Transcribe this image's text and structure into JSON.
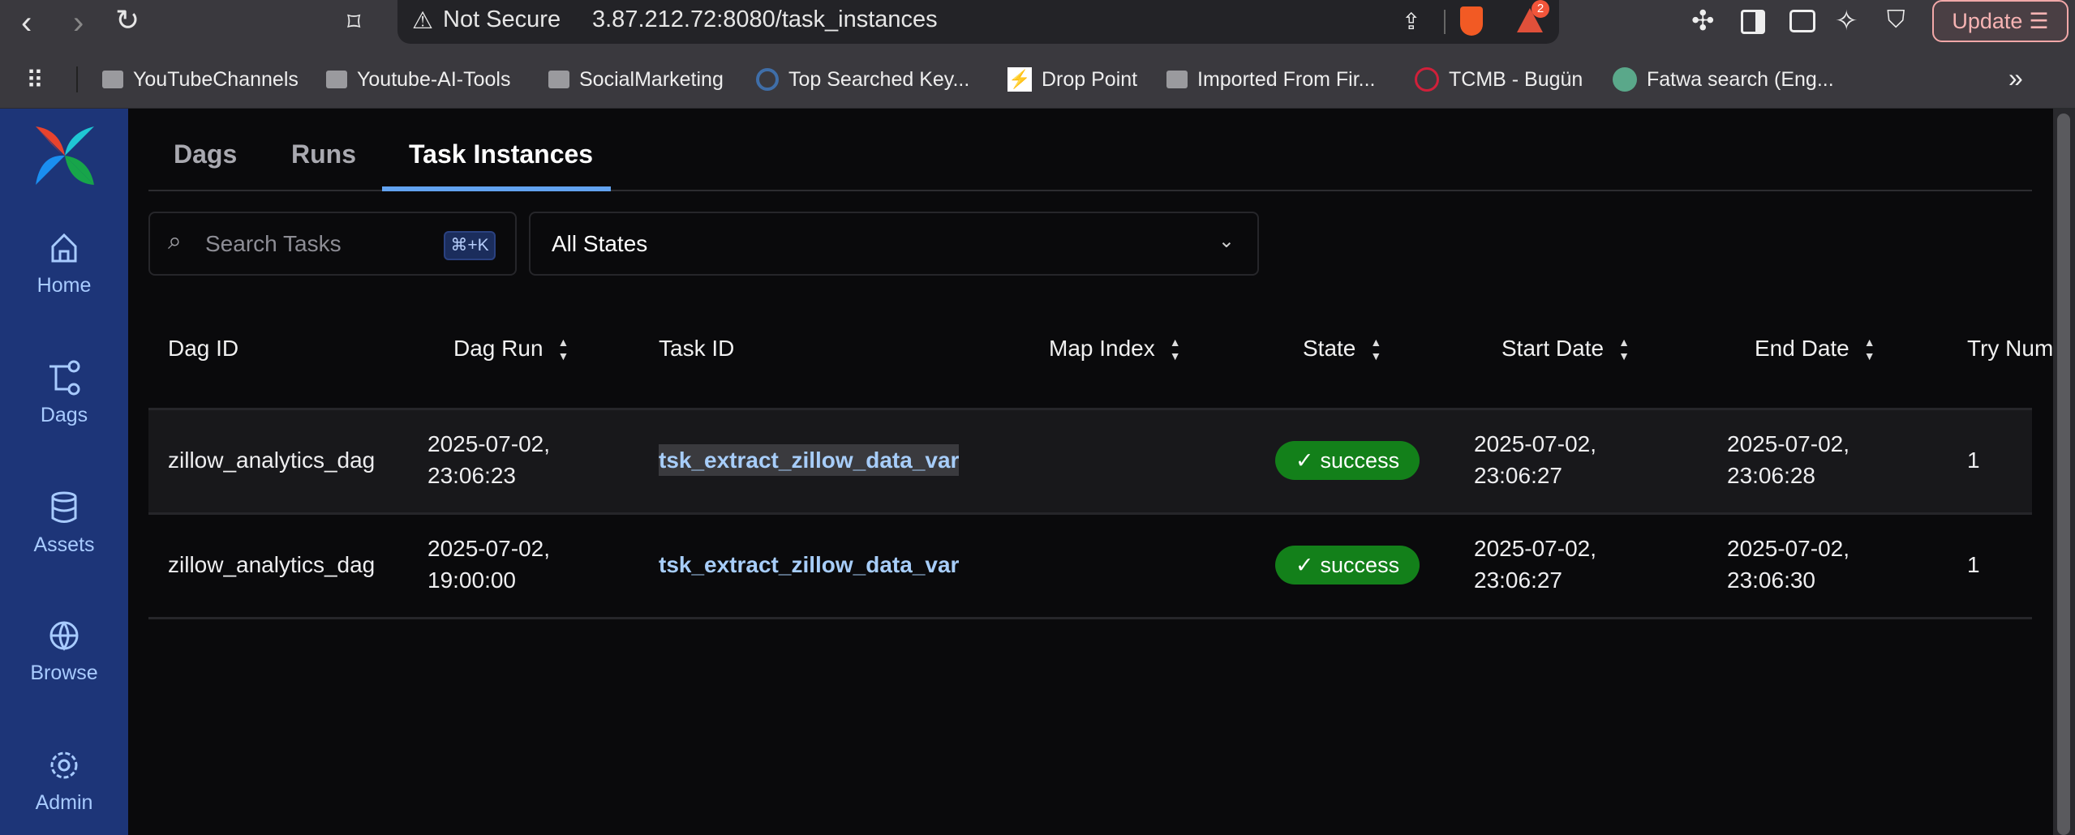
{
  "browser": {
    "security_label": "Not Secure",
    "url": "3.87.212.72:8080/task_instances",
    "extension_badge": "2",
    "update_label": "Update",
    "bookmarks": [
      "YouTubeChannels",
      "Youtube-AI-Tools",
      "SocialMarketing",
      "Top Searched Key...",
      "Drop Point",
      "Imported From Fir...",
      "TCMB - Bugün",
      "Fatwa search (Eng..."
    ],
    "more": "»"
  },
  "sidebar": {
    "items": [
      {
        "label": "Home"
      },
      {
        "label": "Dags"
      },
      {
        "label": "Assets"
      },
      {
        "label": "Browse"
      },
      {
        "label": "Admin"
      }
    ]
  },
  "tabs": [
    {
      "label": "Dags"
    },
    {
      "label": "Runs"
    },
    {
      "label": "Task Instances",
      "active": true
    }
  ],
  "search": {
    "placeholder": "Search Tasks",
    "shortcut": "⌘+K"
  },
  "state_filter": {
    "value": "All States"
  },
  "table": {
    "columns": [
      "Dag ID",
      "Dag Run",
      "Task ID",
      "Map Index",
      "State",
      "Start Date",
      "End Date",
      "Try Num"
    ],
    "rows": [
      {
        "dag_id": "zillow_analytics_dag",
        "dag_run_date": "2025-07-02,",
        "dag_run_time": "23:06:23",
        "task_id": "tsk_extract_zillow_data_var",
        "map_index": "",
        "state": "success",
        "start_date": "2025-07-02,",
        "start_time": "23:06:27",
        "end_date": "2025-07-02,",
        "end_time": "23:06:28",
        "try_num": "1"
      },
      {
        "dag_id": "zillow_analytics_dag",
        "dag_run_date": "2025-07-02,",
        "dag_run_time": "19:00:00",
        "task_id": "tsk_extract_zillow_data_var",
        "map_index": "",
        "state": "success",
        "start_date": "2025-07-02,",
        "start_time": "23:06:27",
        "end_date": "2025-07-02,",
        "end_time": "23:06:30",
        "try_num": "1"
      }
    ]
  },
  "colors": {
    "sidebar": "#1d3578",
    "accent": "#62a3f0",
    "success": "#13801a"
  }
}
